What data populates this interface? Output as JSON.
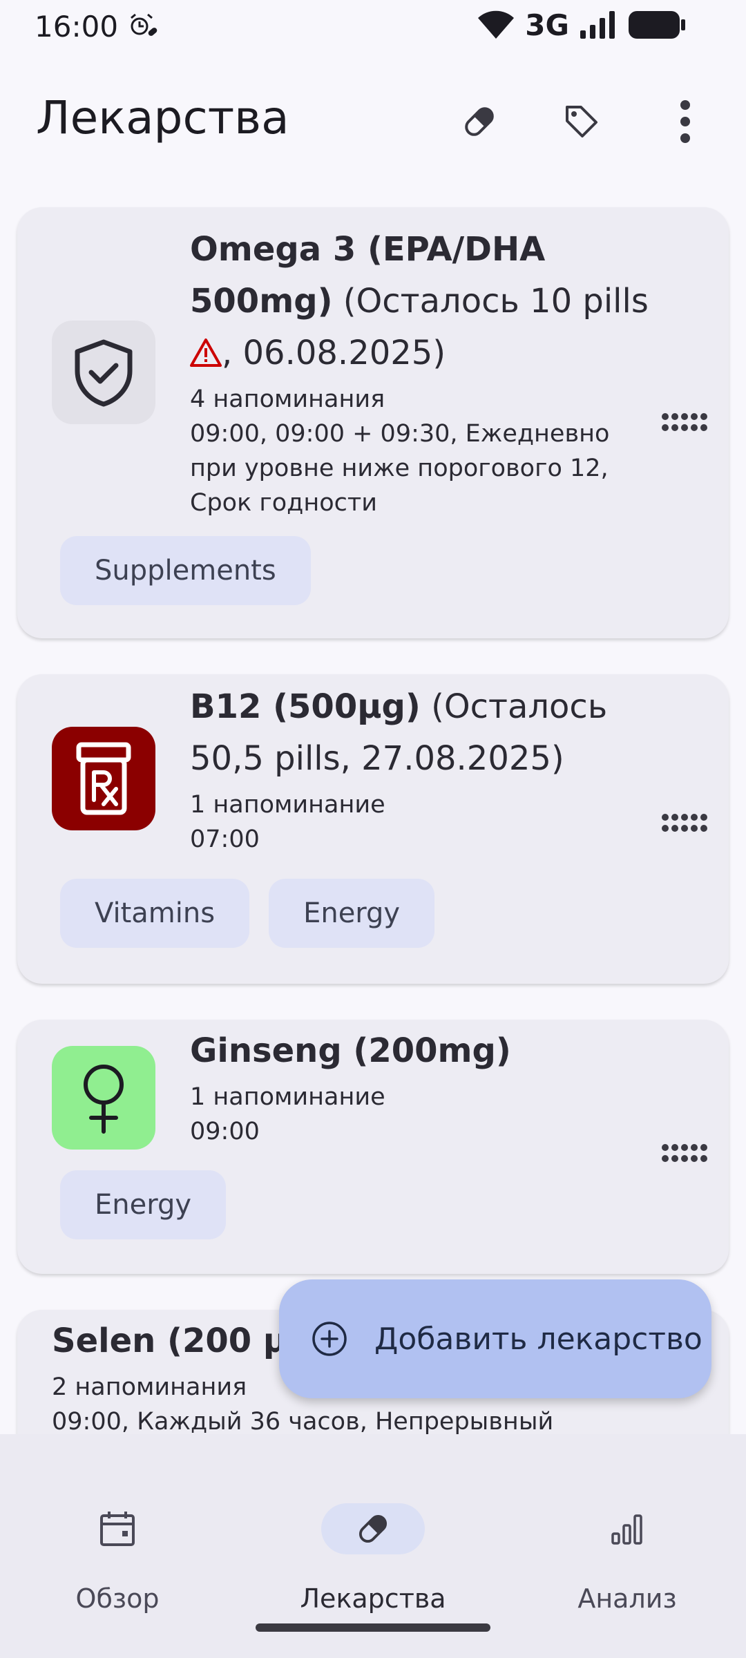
{
  "status_bar": {
    "time": "16:00",
    "network": "3G"
  },
  "app_bar": {
    "title": "Лекарства",
    "icons": [
      "pill-icon",
      "tag-icon",
      "more-vert-icon"
    ]
  },
  "medicines": [
    {
      "name": "Omega 3 (EPA/DHA 500mg)",
      "stock_prefix": " (Осталось 10 pills ",
      "stock_suffix": ", 06.08.2025)",
      "warning_icon": "warning-icon",
      "reminders": "4 напоминания",
      "schedule_1": "09:00, 09:00 + 09:30, Ежедневно",
      "schedule_2": "при уровне ниже порогового 12,",
      "schedule_3": "Срок годности",
      "icon": "shield-check-icon",
      "tags": [
        "Supplements"
      ]
    },
    {
      "name": "B12 (500µg)",
      "stock": " (Осталось 50,5 pills, 27.08.2025)",
      "reminders": "1 напоминание",
      "schedule_1": "07:00",
      "icon": "rx-bottle-icon",
      "tags": [
        "Vitamins",
        "Energy"
      ]
    },
    {
      "name": "Ginseng (200mg)",
      "reminders": "1 напоминание",
      "schedule_1": "09:00",
      "icon": "female-symbol-icon",
      "tags": [
        "Energy"
      ]
    },
    {
      "name": "Selen (200 µg",
      "reminders": "2 напоминания",
      "schedule_1": "09:00, Каждый 36 часов, Непрерывный"
    }
  ],
  "fab": {
    "label": "Добавить лекарство",
    "icon": "add-circle-icon"
  },
  "bottom_nav": [
    {
      "label": "Обзор",
      "icon": "calendar-icon",
      "active": false
    },
    {
      "label": "Лекарства",
      "icon": "pill-icon",
      "active": true
    },
    {
      "label": "Анализ",
      "icon": "bar-chart-icon",
      "active": false
    }
  ],
  "colors": {
    "background": "#f8f7fc",
    "card": "#edecf3",
    "chip": "#dfe2f6",
    "fab": "#b1c1f1",
    "nav_active": "#dbe0f5",
    "rx_icon_bg": "#8b0000",
    "ginseng_icon_bg": "#90ee90",
    "warning": "#cc0000"
  }
}
